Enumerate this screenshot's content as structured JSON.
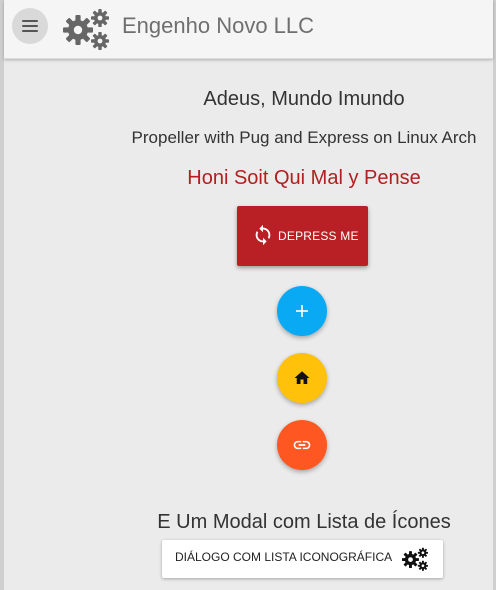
{
  "appbar": {
    "title": "Engenho Novo LLC",
    "menu_icon": "hamburger-menu-icon",
    "logo_icon": "gears-icon"
  },
  "main": {
    "heading": "Adeus, Mundo Imundo",
    "subheading": "Propeller with Pug and Express on Linux Arch",
    "motto": "Honi Soit Qui Mal y Pense",
    "motto_color": "#b21f1f",
    "depress_button": {
      "label": "DEPRESS ME",
      "icon": "refresh-icon",
      "color": "#b82025"
    },
    "fabs": [
      {
        "icon": "plus-icon",
        "color": "#09a9f4"
      },
      {
        "icon": "home-icon",
        "color": "#ffc10a"
      },
      {
        "icon": "link-icon",
        "color": "#fe5722"
      }
    ],
    "modal_heading": "E Um Modal com Lista de Ícones",
    "dialog_button": {
      "label": "DIÁLOGO COM LISTA ICONOGRÁFICA",
      "icon": "gears-icon"
    }
  }
}
